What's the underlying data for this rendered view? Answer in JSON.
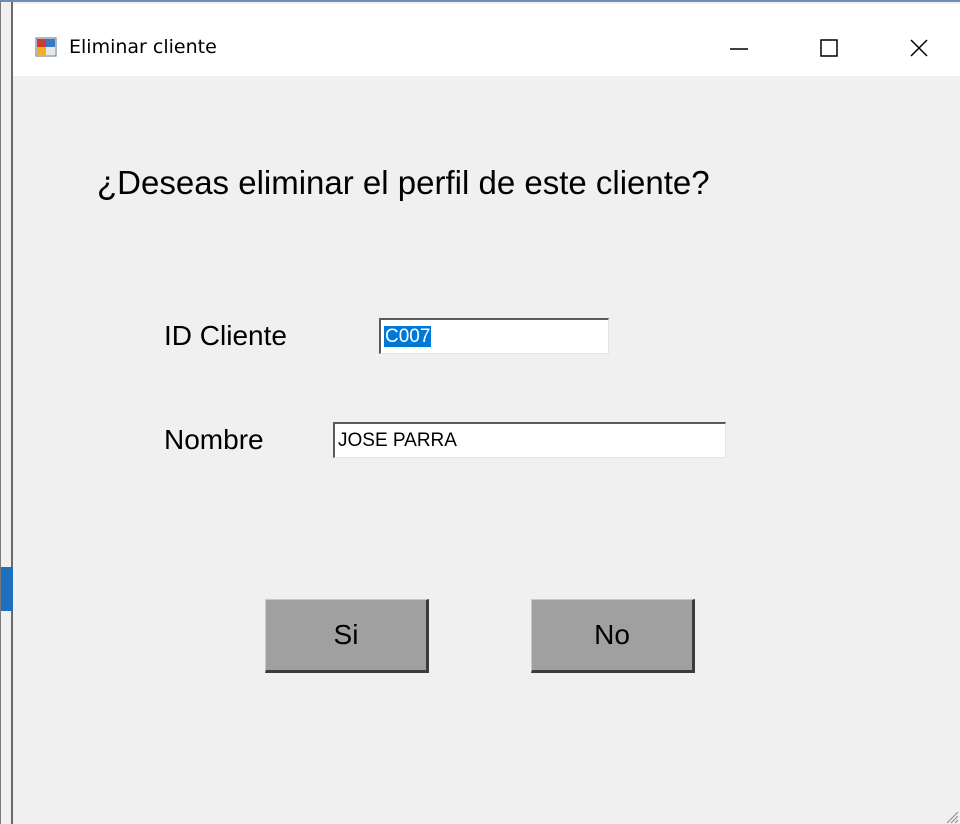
{
  "window": {
    "title": "Eliminar cliente",
    "controls": {
      "minimize_icon": "minimize-icon",
      "maximize_icon": "maximize-icon",
      "close_icon": "close-icon"
    }
  },
  "dialog": {
    "question": "¿Deseas eliminar el perfil de este cliente?",
    "fields": {
      "id_label": "ID Cliente",
      "id_value": "C007",
      "nombre_label": "Nombre",
      "nombre_value": "JOSE PARRA"
    },
    "buttons": {
      "yes_label": "Si",
      "no_label": "No"
    }
  },
  "colors": {
    "selection": "#0078d7",
    "button_face": "#a0a0a0",
    "background": "#f0f0f0"
  }
}
